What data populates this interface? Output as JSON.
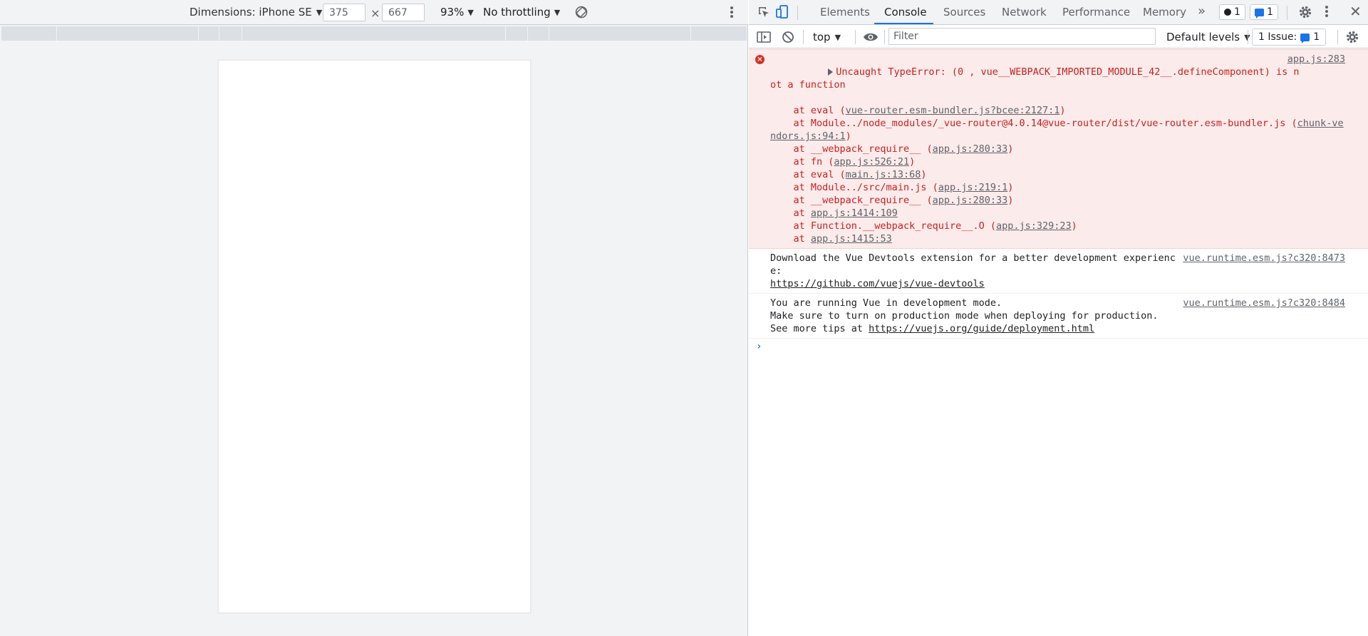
{
  "device_toolbar": {
    "dimensions_label": "Dimensions: iPhone SE",
    "width": "375",
    "times": "×",
    "height": "667",
    "zoom": "93%",
    "throttling": "No throttling"
  },
  "devtools_tabs": {
    "items": [
      "Elements",
      "Console",
      "Sources",
      "Network",
      "Performance",
      "Memory"
    ],
    "active": "Console",
    "more": "»",
    "errors_count": "1",
    "messages_count": "1",
    "close": "✕"
  },
  "console_toolbar": {
    "context": "top",
    "filter_placeholder": "Filter",
    "levels": "Default levels",
    "issues_label": "1 Issue:",
    "issues_count": "1"
  },
  "console": {
    "error": {
      "message": "Uncaught TypeError: (0 , vue__WEBPACK_IMPORTED_MODULE_42__.defineComponent) is not a function",
      "source": "app.js:283",
      "stack": [
        {
          "pre": "    at eval (",
          "link": "vue-router.esm-bundler.js?bcee:2127:1",
          "post": ")"
        },
        {
          "pre": "    at Module../node_modules/_vue-router@4.0.14@vue-router/dist/vue-router.esm-bundler.js (",
          "link": "chunk-vendors.js:94:1",
          "post": ")"
        },
        {
          "pre": "    at __webpack_require__ (",
          "link": "app.js:280:33",
          "post": ")"
        },
        {
          "pre": "    at fn (",
          "link": "app.js:526:21",
          "post": ")"
        },
        {
          "pre": "    at eval (",
          "link": "main.js:13:68",
          "post": ")"
        },
        {
          "pre": "    at Module../src/main.js (",
          "link": "app.js:219:1",
          "post": ")"
        },
        {
          "pre": "    at __webpack_require__ (",
          "link": "app.js:280:33",
          "post": ")"
        },
        {
          "pre": "    at ",
          "link": "app.js:1414:109",
          "post": ""
        },
        {
          "pre": "    at Function.__webpack_require__.O (",
          "link": "app.js:329:23",
          "post": ")"
        },
        {
          "pre": "    at ",
          "link": "app.js:1415:53",
          "post": ""
        }
      ]
    },
    "messages": [
      {
        "text": "Download the Vue Devtools extension for a better development experience:",
        "link": "https://github.com/vuejs/vue-devtools",
        "source": "vue.runtime.esm.js?c320:8473"
      },
      {
        "text": "You are running Vue in development mode.\nMake sure to turn on production mode when deploying for production.\nSee more tips at ",
        "link": "https://vuejs.org/guide/deployment.html",
        "source": "vue.runtime.esm.js?c320:8484"
      }
    ],
    "prompt": "›"
  }
}
